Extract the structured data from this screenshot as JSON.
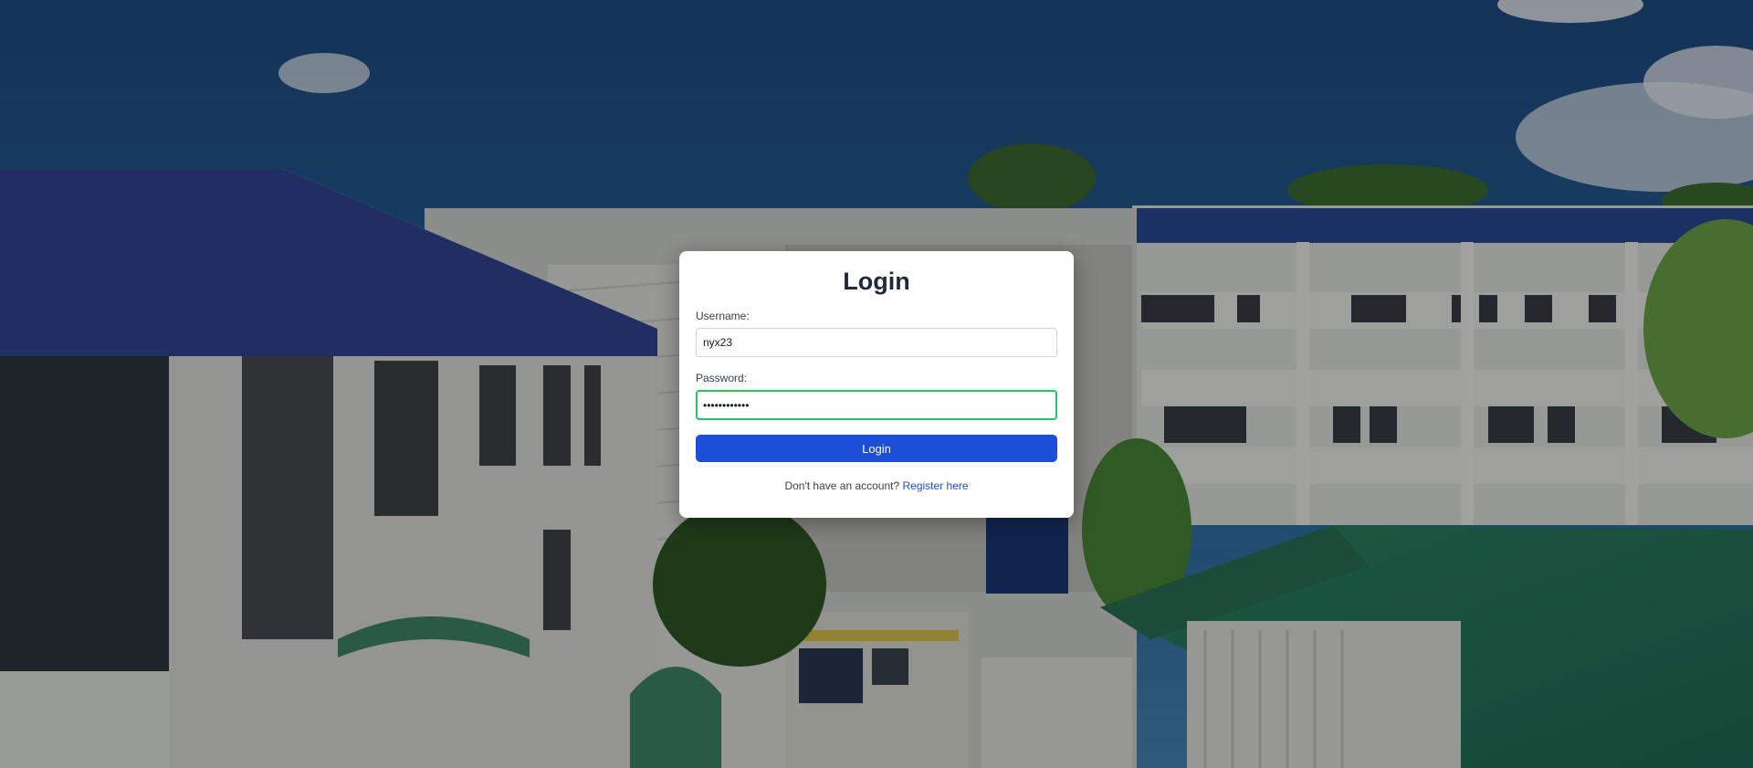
{
  "login_card": {
    "title": "Login",
    "username": {
      "label": "Username:",
      "value": "nyx23"
    },
    "password": {
      "label": "Password:",
      "value": "••••••••••••"
    },
    "submit_label": "Login",
    "register_prompt": "Don't have an account?",
    "register_link": "Register here"
  },
  "colors": {
    "primary_button": "#1d4ed8",
    "focus_ring": "#22c55e",
    "link": "#1d4ed8",
    "title": "#1e2939"
  },
  "background": {
    "description_icon": "campus-building-photo"
  }
}
